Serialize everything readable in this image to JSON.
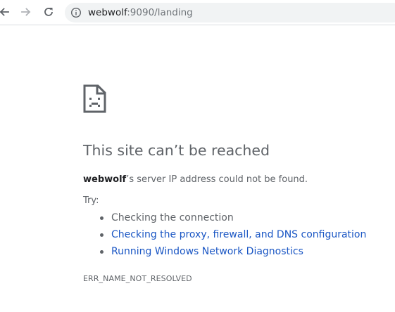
{
  "browser": {
    "url_host": "webwolf",
    "url_rest": ":9090/landing",
    "icons": {
      "back": "arrow-left-icon",
      "forward": "arrow-right-icon",
      "reload": "reload-icon",
      "info": "info-icon"
    }
  },
  "error_page": {
    "icon": "sad-page-icon",
    "heading": "This site can’t be reached",
    "desc_host": "webwolf",
    "desc_rest": "’s server IP address could not be found.",
    "try_label": "Try:",
    "suggestions": [
      "Checking the connection",
      "Checking the proxy, firewall, and DNS configuration",
      "Running Windows Network Diagnostics"
    ],
    "error_code": "ERR_NAME_NOT_RESOLVED"
  },
  "colors": {
    "text": "#5f6368",
    "link": "#1a56c4",
    "omnibox_bg": "#f1f3f4"
  }
}
